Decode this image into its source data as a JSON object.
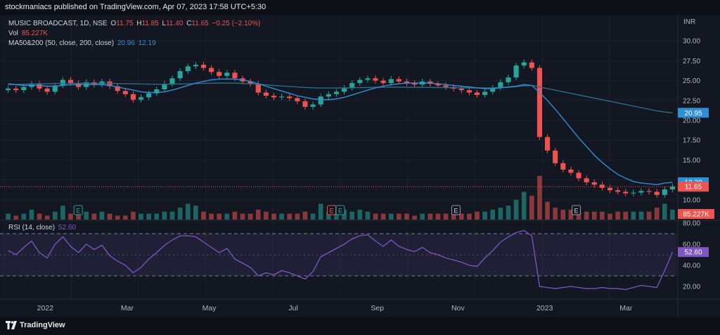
{
  "header": {
    "published_text": "stockmaniacs published on TradingView.com, Apr 07, 2023 17:58 UTC+5:30"
  },
  "footer": {
    "brand": "TradingView"
  },
  "legend": {
    "symbol": "MUSIC BROADCAST, 1D, NSE",
    "o_label": "O",
    "o_value": "11.75",
    "h_label": "H",
    "h_value": "11.85",
    "l_label": "L",
    "l_value": "11.40",
    "c_label": "C",
    "c_value": "11.65",
    "change": "−0.25 (−2.10%)",
    "vol_label": "Vol",
    "vol_value": "85.227K",
    "ma_label": "MA50&200 (50, close, 200, close)",
    "ma50_value": "20.96",
    "ma200_value": "12.19",
    "rsi_label": "RSI (14, close)",
    "rsi_value": "52.60"
  },
  "colors": {
    "up": "#26a69a",
    "down": "#ef5350",
    "ma50": "#2f8fd6",
    "ma200": "#2a6f88",
    "rsi": "#7e57c2",
    "background": "#131722"
  },
  "chart_data": {
    "type": "candlestick",
    "currency": "INR",
    "price_axis": {
      "ylim": [
        7.5,
        32.5
      ],
      "ticks": [
        "30.00",
        "27.50",
        "25.00",
        "22.50",
        "20.00",
        "17.50",
        "15.00",
        "12.50",
        "10.00"
      ]
    },
    "rsi_axis": {
      "ylim": [
        10,
        82
      ],
      "ticks": [
        "80.00",
        "60.00",
        "40.00",
        "20.00"
      ],
      "bands": [
        30,
        70
      ],
      "mid": 50
    },
    "x_axis": {
      "ticks": [
        "2022",
        "Mar",
        "May",
        "Jul",
        "Sep",
        "Nov",
        "2023",
        "Mar"
      ]
    },
    "price_labels": [
      {
        "value": 20.95,
        "label": "20.95",
        "color": "#2f8fd6"
      },
      {
        "value": 12.2,
        "label": "12.20",
        "color": "#2f8fd6"
      },
      {
        "value": 11.65,
        "label": "11.65",
        "color": "#ef5350"
      }
    ],
    "volume_label": "85.227K",
    "rsi_label": "52.60",
    "earnings_markers": [
      "E",
      "E",
      "E",
      "E",
      "E"
    ],
    "close_series": [
      24.0,
      23.8,
      24.2,
      24.6,
      24.0,
      23.6,
      24.4,
      25.1,
      24.7,
      24.2,
      24.8,
      24.5,
      24.9,
      24.3,
      23.7,
      23.3,
      22.6,
      22.9,
      23.4,
      23.9,
      24.6,
      25.3,
      26.2,
      26.8,
      27.0,
      26.6,
      26.1,
      25.6,
      26.0,
      25.3,
      24.9,
      24.6,
      23.5,
      23.1,
      22.9,
      23.0,
      22.8,
      22.4,
      21.7,
      22.0,
      23.0,
      23.3,
      23.6,
      24.1,
      24.7,
      25.1,
      25.3,
      25.0,
      24.7,
      25.2,
      24.9,
      24.7,
      24.5,
      24.9,
      24.6,
      24.4,
      24.2,
      24.0,
      23.8,
      23.5,
      23.2,
      23.6,
      24.1,
      24.8,
      25.4,
      26.9,
      27.3,
      26.6,
      17.9,
      16.2,
      14.6,
      13.8,
      13.4,
      12.7,
      12.2,
      11.9,
      11.5,
      11.2,
      11.0,
      10.8,
      10.9,
      11.1,
      11.0,
      10.6,
      11.3,
      11.65
    ],
    "ma200_series": [
      24.5,
      24.52,
      24.55,
      24.58,
      24.6,
      24.62,
      24.64,
      24.65,
      24.66,
      24.67,
      24.67,
      24.67,
      24.66,
      24.65,
      24.64,
      24.62,
      24.6,
      24.58,
      24.56,
      24.55,
      24.55,
      24.56,
      24.58,
      24.6,
      24.63,
      24.66,
      24.68,
      24.7,
      24.7,
      24.68,
      24.65,
      24.6,
      24.54,
      24.47,
      24.4,
      24.33,
      24.27,
      24.2,
      24.14,
      24.1,
      24.08,
      24.07,
      24.07,
      24.08,
      24.1,
      24.12,
      24.14,
      24.16,
      24.17,
      24.18,
      24.18,
      24.17,
      24.16,
      24.15,
      24.14,
      24.13,
      24.12,
      24.11,
      24.1,
      24.09,
      24.08,
      24.08,
      24.09,
      24.12,
      24.17,
      24.25,
      24.35,
      24.4,
      24.2,
      24.0,
      23.8,
      23.6,
      23.4,
      23.2,
      23.0,
      22.8,
      22.6,
      22.4,
      22.2,
      22.0,
      21.8,
      21.6,
      21.4,
      21.2,
      21.05,
      20.95
    ],
    "ma50_series": [
      24.6,
      24.5,
      24.4,
      24.4,
      24.4,
      24.3,
      24.3,
      24.4,
      24.5,
      24.5,
      24.5,
      24.5,
      24.5,
      24.4,
      24.2,
      24.0,
      23.8,
      23.6,
      23.5,
      23.5,
      23.6,
      23.8,
      24.1,
      24.4,
      24.7,
      24.9,
      25.1,
      25.2,
      25.2,
      25.2,
      25.1,
      24.9,
      24.6,
      24.3,
      24.0,
      23.7,
      23.4,
      23.1,
      22.9,
      22.7,
      22.6,
      22.6,
      22.7,
      22.9,
      23.2,
      23.5,
      23.8,
      24.1,
      24.3,
      24.5,
      24.6,
      24.7,
      24.7,
      24.7,
      24.7,
      24.6,
      24.5,
      24.4,
      24.3,
      24.2,
      24.1,
      24.0,
      24.0,
      24.1,
      24.2,
      24.3,
      24.5,
      24.4,
      23.5,
      22.5,
      21.4,
      20.2,
      19.0,
      17.8,
      16.7,
      15.6,
      14.7,
      13.9,
      13.2,
      12.7,
      12.3,
      12.1,
      12.0,
      11.9,
      12.1,
      12.19
    ],
    "rsi_series": [
      54,
      50,
      57,
      63,
      52,
      47,
      60,
      67,
      58,
      52,
      60,
      55,
      59,
      49,
      44,
      40,
      33,
      38,
      46,
      52,
      59,
      64,
      68,
      68,
      67,
      62,
      57,
      52,
      56,
      46,
      42,
      38,
      30,
      33,
      31,
      35,
      33,
      30,
      27,
      34,
      48,
      52,
      56,
      60,
      65,
      68,
      69,
      63,
      58,
      64,
      58,
      55,
      53,
      57,
      52,
      50,
      47,
      45,
      43,
      40,
      39,
      47,
      54,
      62,
      67,
      71,
      73,
      68,
      20,
      19,
      18,
      19,
      20,
      19,
      18,
      18,
      19,
      18,
      18,
      17,
      19,
      21,
      20,
      19,
      35,
      52.6
    ],
    "volume_series": [
      3,
      2,
      3,
      5,
      3,
      2,
      4,
      7,
      3,
      3,
      4,
      3,
      4,
      3,
      2,
      2,
      4,
      3,
      3,
      3,
      4,
      4,
      6,
      8,
      7,
      4,
      3,
      3,
      3,
      4,
      3,
      3,
      5,
      4,
      3,
      3,
      3,
      3,
      4,
      3,
      8,
      4,
      5,
      5,
      4,
      5,
      4,
      3,
      3,
      3,
      3,
      3,
      2,
      3,
      3,
      3,
      3,
      3,
      3,
      3,
      4,
      4,
      5,
      6,
      7,
      10,
      14,
      12,
      22,
      9,
      6,
      5,
      5,
      4,
      4,
      4,
      4,
      3,
      4,
      4,
      4,
      4,
      4,
      6,
      8,
      5
    ]
  }
}
